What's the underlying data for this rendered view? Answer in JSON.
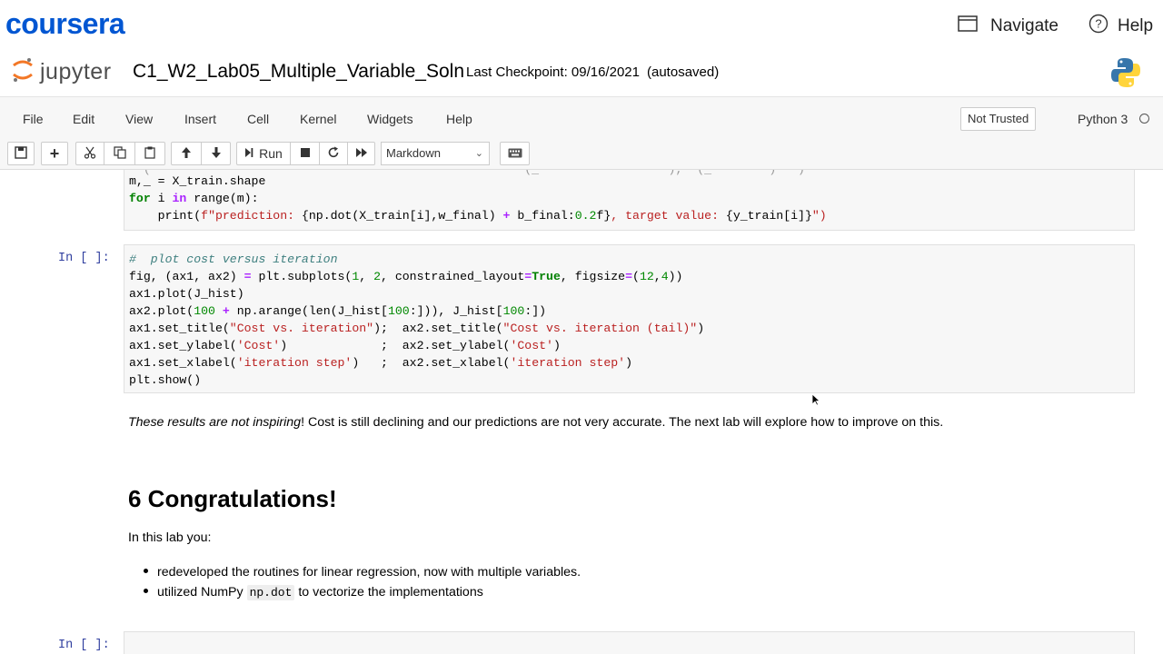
{
  "coursera": {
    "logo": "coursera",
    "navigate_label": "Navigate",
    "help_label": "Help",
    "brand_color": "#0056d2"
  },
  "jupyter": {
    "wordmark": "jupyter",
    "notebook_title": "C1_W2_Lab05_Multiple_Variable_Soln",
    "checkpoint": "Last Checkpoint: 09/16/2021",
    "autosaved": "(autosaved)"
  },
  "menubar": {
    "items": [
      "File",
      "Edit",
      "View",
      "Insert",
      "Cell",
      "Kernel",
      "Widgets",
      "Help"
    ],
    "trust_label": "Not Trusted",
    "kernel_name": "Python 3"
  },
  "toolbar": {
    "run_label": "Run",
    "cell_type": "Markdown",
    "icons": [
      "save-icon",
      "plus-icon",
      "cut-icon",
      "copy-icon",
      "paste-icon",
      "arrow-up-icon",
      "arrow-down-icon",
      "stop-icon",
      "restart-icon",
      "fast-forward-icon",
      "keyboard-icon"
    ]
  },
  "cells": {
    "prev_code_lines": [
      "m,_ = X_train.shape",
      "for i in range(m):",
      "    print(f\"prediction: {np.dot(X_train[i],w_final) + b_final:0.2f}, target value: {y_train[i]}\")"
    ],
    "plot_prompt": "In [ ]:",
    "plot_code_lines": [
      "# plot cost versus iteration",
      "fig, (ax1, ax2) = plt.subplots(1, 2, constrained_layout=True, figsize=(12,4))",
      "ax1.plot(J_hist)",
      "ax2.plot(100 + np.arange(len(J_hist[100:])), J_hist[100:])",
      "ax1.set_title(\"Cost vs. iteration\");  ax2.set_title(\"Cost vs. iteration (tail)\")",
      "ax1.set_ylabel('Cost')             ;  ax2.set_ylabel('Cost')",
      "ax1.set_xlabel('iteration step')   ;  ax2.set_xlabel('iteration step')",
      "plt.show()"
    ],
    "md_emphasis": "These results are not inspiring",
    "md_rest": "! Cost is still declining and our predictions are not very accurate. The next lab will explore how to improve on this.",
    "section_heading": "6 Congratulations!",
    "lab_intro": "In this lab you:",
    "bullet1": "redeveloped the routines for linear regression, now with multiple variables.",
    "bullet2_pre": "utilized NumPy",
    "bullet2_code": "np.dot",
    "bullet2_post": "to vectorize the implementations",
    "last_prompt": "In [ ]:"
  }
}
